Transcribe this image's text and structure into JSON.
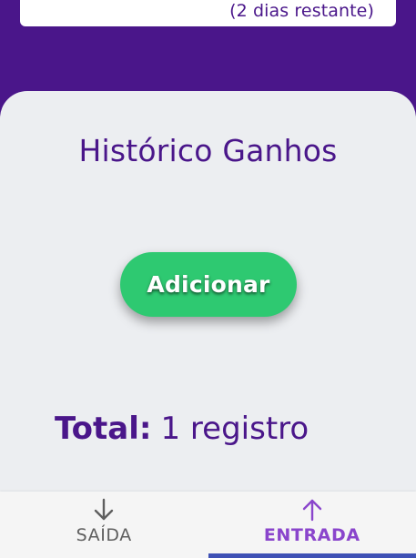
{
  "top_card": {
    "remaining_text": "(2 dias restante)"
  },
  "main": {
    "title": "Histórico Ganhos",
    "add_button_label": "Adicionar",
    "total_label": "Total:",
    "total_value": "1 registro"
  },
  "bottom_nav": {
    "tabs": [
      {
        "label": "SAÍDA",
        "icon": "arrow-down-icon",
        "active": false
      },
      {
        "label": "ENTRADA",
        "icon": "arrow-up-icon",
        "active": true
      }
    ]
  },
  "colors": {
    "brand_purple": "#4a168a",
    "add_button_green": "#2ec971",
    "panel_background": "#eceef1",
    "active_tab": "#8a45cc",
    "active_indicator": "#3f51b5"
  }
}
